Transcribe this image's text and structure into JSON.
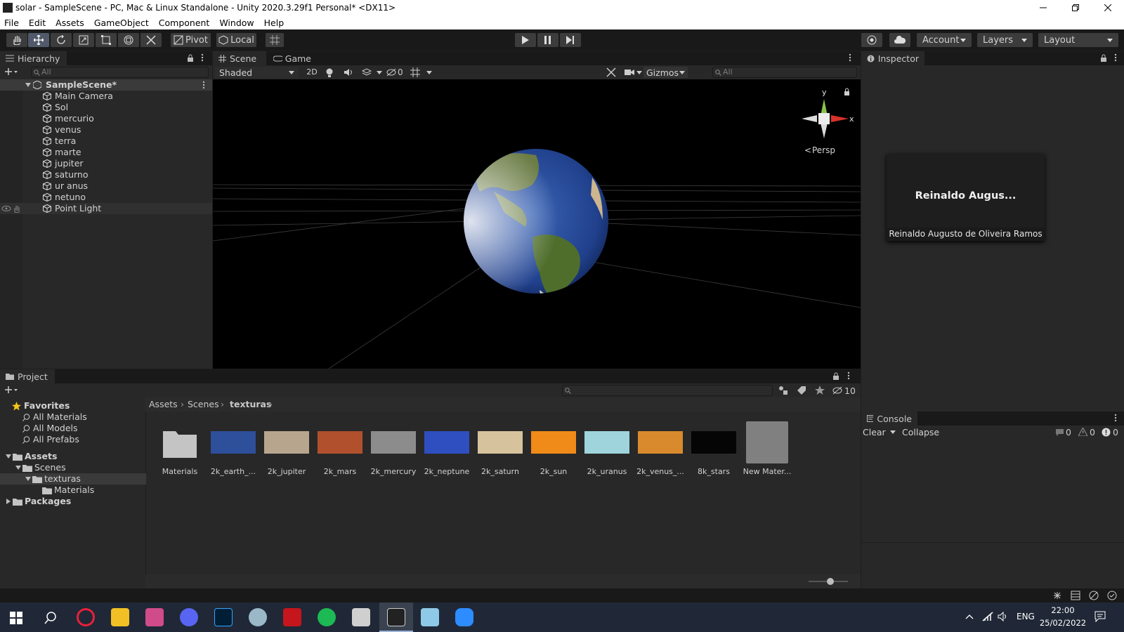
{
  "window": {
    "title": "solar - SampleScene - PC, Mac & Linux Standalone - Unity 2020.3.29f1 Personal* <DX11>"
  },
  "menu": [
    "File",
    "Edit",
    "Assets",
    "GameObject",
    "Component",
    "Window",
    "Help"
  ],
  "toolbar": {
    "pivot": "Pivot",
    "local": "Local",
    "account": "Account",
    "layers": "Layers",
    "layout": "Layout"
  },
  "hierarchy": {
    "tab": "Hierarchy",
    "search_placeholder": "All",
    "scene": "SampleScene*",
    "items": [
      "Main Camera",
      "Sol",
      "mercurio",
      "venus",
      "terra",
      "marte",
      "jupiter",
      "saturno",
      "ur anus",
      "netuno",
      "Point Light"
    ]
  },
  "scene": {
    "tabs": [
      "Scene",
      "Game"
    ],
    "shading": "Shaded",
    "mode_2d": "2D",
    "hidden_count": "0",
    "gizmos": "Gizmos",
    "search_placeholder": "All",
    "persp": "Persp",
    "axis_y": "y",
    "axis_x": "x"
  },
  "inspector": {
    "tab": "Inspector",
    "user_short": "Reinaldo Augus...",
    "user_full": "Reinaldo Augusto de Oliveira Ramos"
  },
  "project": {
    "tab": "Project",
    "hidden_count": "10",
    "favorites": {
      "label": "Favorites",
      "items": [
        "All Materials",
        "All Models",
        "All Prefabs"
      ]
    },
    "tree": {
      "assets": "Assets",
      "scenes": "Scenes",
      "texturas": "texturas",
      "materials": "Materials",
      "packages": "Packages"
    },
    "breadcrumb": [
      "Assets",
      "Scenes",
      "texturas"
    ],
    "assets": [
      {
        "name": "Materials",
        "color": "#c4c4c4"
      },
      {
        "name": "2k_earth_...",
        "color": "#2e4f9a"
      },
      {
        "name": "2k_jupiter",
        "color": "#b8a58e"
      },
      {
        "name": "2k_mars",
        "color": "#b0502d"
      },
      {
        "name": "2k_mercury",
        "color": "#8c8c8c"
      },
      {
        "name": "2k_neptune",
        "color": "#2f4fc0"
      },
      {
        "name": "2k_saturn",
        "color": "#d6c39e"
      },
      {
        "name": "2k_sun",
        "color": "#f08a18"
      },
      {
        "name": "2k_uranus",
        "color": "#9fd4dc"
      },
      {
        "name": "2k_venus_...",
        "color": "#d98a2c"
      },
      {
        "name": "8k_stars",
        "color": "#050505"
      },
      {
        "name": "New Mater...",
        "color": "#808080"
      }
    ]
  },
  "console": {
    "tab": "Console",
    "clear": "Clear",
    "collapse": "Collapse",
    "info": "0",
    "warn": "0",
    "error": "0"
  },
  "taskbar": {
    "lang": "ENG",
    "time": "22:00",
    "date": "25/02/2022"
  }
}
